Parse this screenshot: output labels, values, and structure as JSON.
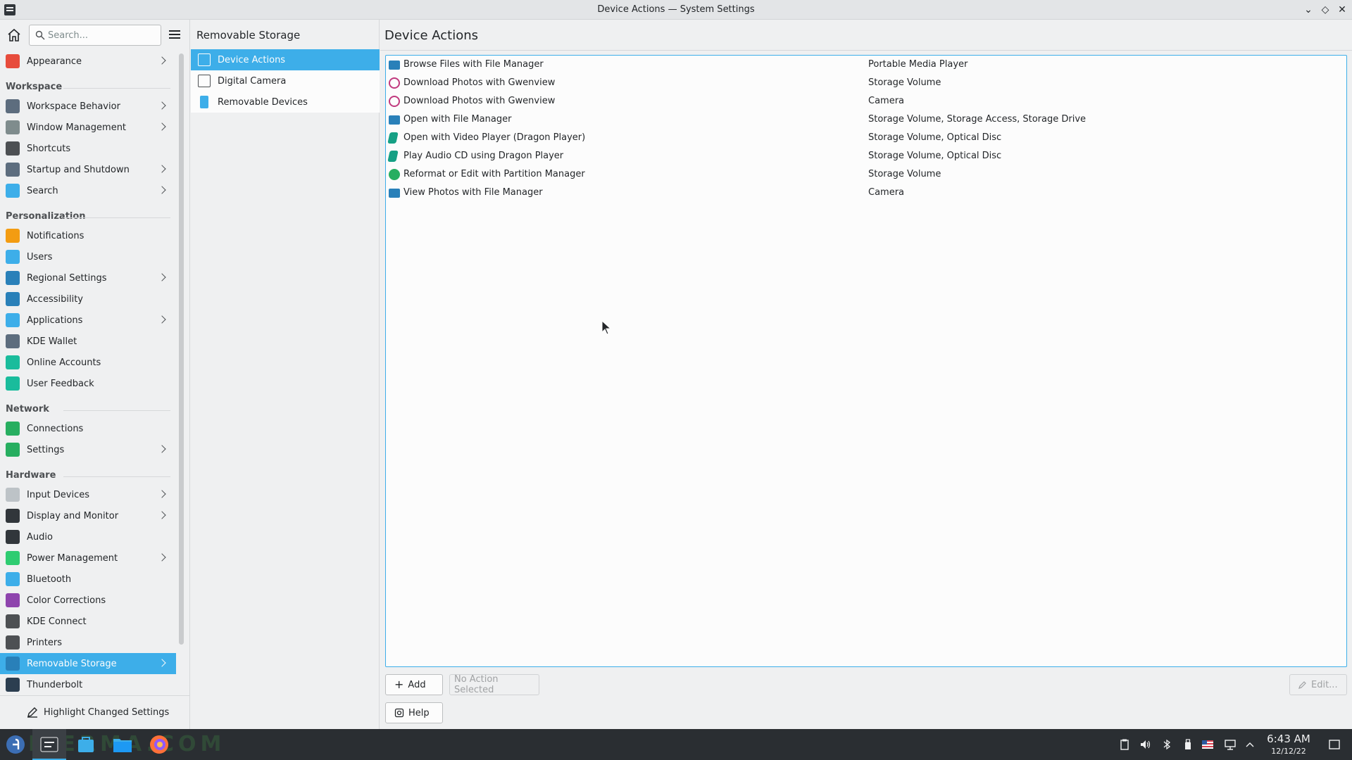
{
  "window": {
    "title": "Device Actions — System Settings",
    "minimize": "⌄",
    "maximize": "◇",
    "close": "✕"
  },
  "sidebar": {
    "search_placeholder": "Search...",
    "groups": [
      {
        "category": "",
        "items": [
          {
            "label": "Appearance",
            "icon": "appearance-icon",
            "color": "#e74c3c",
            "has_children": true
          }
        ]
      },
      {
        "category": "Workspace",
        "items": [
          {
            "label": "Workspace Behavior",
            "icon": "workspace-behavior-icon",
            "color": "#5d6d7e",
            "has_children": true
          },
          {
            "label": "Window Management",
            "icon": "window-management-icon",
            "color": "#7f8c8d",
            "has_children": true
          },
          {
            "label": "Shortcuts",
            "icon": "keyboard-icon",
            "color": "#4d5053",
            "has_children": false
          },
          {
            "label": "Startup and Shutdown",
            "icon": "startup-icon",
            "color": "#5d6d7e",
            "has_children": true
          },
          {
            "label": "Search",
            "icon": "search-settings-icon",
            "color": "#3daee9",
            "has_children": true
          }
        ]
      },
      {
        "category": "Personalization",
        "items": [
          {
            "label": "Notifications",
            "icon": "bell-icon",
            "color": "#f39c12",
            "has_children": false
          },
          {
            "label": "Users",
            "icon": "users-icon",
            "color": "#3daee9",
            "has_children": false
          },
          {
            "label": "Regional Settings",
            "icon": "regional-icon",
            "color": "#2980b9",
            "has_children": true
          },
          {
            "label": "Accessibility",
            "icon": "accessibility-icon",
            "color": "#2980b9",
            "has_children": false
          },
          {
            "label": "Applications",
            "icon": "applications-icon",
            "color": "#3daee9",
            "has_children": true
          },
          {
            "label": "KDE Wallet",
            "icon": "wallet-icon",
            "color": "#5d6d7e",
            "has_children": false
          },
          {
            "label": "Online Accounts",
            "icon": "online-accounts-icon",
            "color": "#1abc9c",
            "has_children": false
          },
          {
            "label": "User Feedback",
            "icon": "feedback-icon",
            "color": "#1abc9c",
            "has_children": false
          }
        ]
      },
      {
        "category": "Network",
        "items": [
          {
            "label": "Connections",
            "icon": "connections-icon",
            "color": "#27ae60",
            "has_children": false
          },
          {
            "label": "Settings",
            "icon": "network-settings-icon",
            "color": "#27ae60",
            "has_children": true
          }
        ]
      },
      {
        "category": "Hardware",
        "items": [
          {
            "label": "Input Devices",
            "icon": "mouse-icon",
            "color": "#bdc3c7",
            "has_children": true
          },
          {
            "label": "Display and Monitor",
            "icon": "monitor-icon",
            "color": "#31363b",
            "has_children": true
          },
          {
            "label": "Audio",
            "icon": "speaker-icon",
            "color": "#31363b",
            "has_children": false
          },
          {
            "label": "Power Management",
            "icon": "power-icon",
            "color": "#2ecc71",
            "has_children": true
          },
          {
            "label": "Bluetooth",
            "icon": "bluetooth-icon",
            "color": "#3daee9",
            "has_children": false
          },
          {
            "label": "Color Corrections",
            "icon": "color-corrections-icon",
            "color": "#8e44ad",
            "has_children": false
          },
          {
            "label": "KDE Connect",
            "icon": "phone-icon",
            "color": "#4d5053",
            "has_children": false
          },
          {
            "label": "Printers",
            "icon": "printer-icon",
            "color": "#4d5053",
            "has_children": false
          },
          {
            "label": "Removable Storage",
            "icon": "usb-drive-icon",
            "color": "#2980b9",
            "has_children": true,
            "selected": true
          },
          {
            "label": "Thunderbolt",
            "icon": "thunderbolt-icon",
            "color": "#2c3e50",
            "has_children": false
          }
        ]
      }
    ],
    "highlight_button": "Highlight Changed Settings"
  },
  "middle": {
    "title": "Removable Storage",
    "items": [
      {
        "label": "Device Actions",
        "icon": "device-actions-icon",
        "selected": true
      },
      {
        "label": "Digital Camera",
        "icon": "camera-icon",
        "selected": false
      },
      {
        "label": "Removable Devices",
        "icon": "removable-devices-icon",
        "selected": false
      }
    ]
  },
  "main": {
    "title": "Device Actions",
    "actions": [
      {
        "name": "Browse Files with File Manager",
        "types": "Portable Media Player",
        "icon": "folder-icon",
        "color": "#2980b9"
      },
      {
        "name": "Download Photos with Gwenview",
        "types": "Storage Volume",
        "icon": "gwenview-icon",
        "color": "#c0397e"
      },
      {
        "name": "Download Photos with Gwenview",
        "types": "Camera",
        "icon": "gwenview-icon",
        "color": "#c0397e"
      },
      {
        "name": "Open with File Manager",
        "types": "Storage Volume, Storage Access, Storage Drive",
        "icon": "folder-icon",
        "color": "#2980b9"
      },
      {
        "name": "Open with Video Player (Dragon Player)",
        "types": "Storage Volume, Optical Disc",
        "icon": "dragon-player-icon",
        "color": "#16a085"
      },
      {
        "name": "Play Audio CD using Dragon Player",
        "types": "Storage Volume, Optical Disc",
        "icon": "dragon-player-icon",
        "color": "#16a085"
      },
      {
        "name": "Reformat or Edit with Partition Manager",
        "types": "Storage Volume",
        "icon": "partition-manager-icon",
        "color": "#27ae60"
      },
      {
        "name": "View Photos with File Manager",
        "types": "Camera",
        "icon": "folder-icon",
        "color": "#2980b9"
      }
    ],
    "add_button": "Add",
    "no_action_button": "No Action Selected",
    "edit_button": "Edit...",
    "help_button": "Help"
  },
  "taskbar": {
    "time": "6:43 AM",
    "date": "12/12/22",
    "watermark": "IKERMA.COM"
  }
}
